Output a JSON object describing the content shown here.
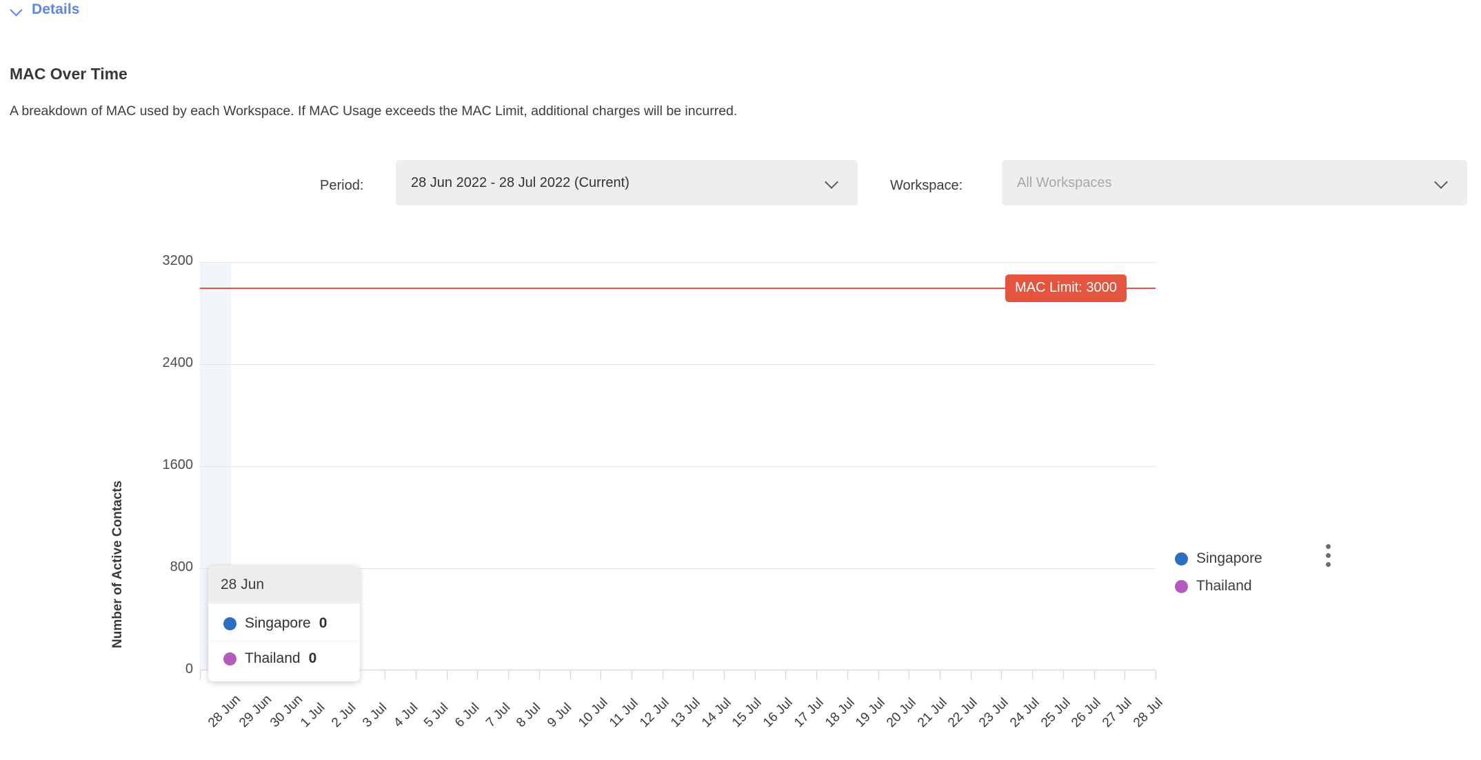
{
  "details": {
    "label": "Details",
    "icon": "chevron-down-icon"
  },
  "section": {
    "title": "MAC Over Time",
    "description": "A breakdown of MAC used by each Workspace. If MAC Usage exceeds the MAC Limit, additional charges will be incurred."
  },
  "filters": {
    "period": {
      "label": "Period:",
      "value": "28 Jun 2022 - 28 Jul 2022 (Current)",
      "caret_icon": "chevron-down-icon"
    },
    "workspace": {
      "label": "Workspace:",
      "value": "All Workspaces",
      "placeholder": "All Workspaces",
      "caret_icon": "chevron-down-icon"
    }
  },
  "legend": {
    "items": [
      {
        "label": "Singapore",
        "color": "#2e6ebf"
      },
      {
        "label": "Thailand",
        "color": "#b45bbf"
      }
    ],
    "menu_icon": "kebab-menu-icon"
  },
  "tooltip": {
    "date": "28 Jun",
    "rows": [
      {
        "label": "Singapore",
        "value": "0",
        "color": "#2e6ebf"
      },
      {
        "label": "Thailand",
        "value": "0",
        "color": "#b45bbf"
      }
    ]
  },
  "limit": {
    "badge": "MAC Limit: 3000",
    "value": 3000,
    "color": "#e4543f"
  },
  "chart_data": {
    "type": "bar",
    "title": "MAC Over Time",
    "xlabel": "",
    "ylabel": "Number of Active Contacts",
    "ylim": [
      0,
      3200
    ],
    "yticks": [
      0,
      800,
      1600,
      2400,
      3200
    ],
    "grid": true,
    "legend_position": "right",
    "categories": [
      "28 Jun",
      "29 Jun",
      "30 Jun",
      "1 Jul",
      "2 Jul",
      "3 Jul",
      "4 Jul",
      "5 Jul",
      "6 Jul",
      "7 Jul",
      "8 Jul",
      "9 Jul",
      "10 Jul",
      "11 Jul",
      "12 Jul",
      "13 Jul",
      "14 Jul",
      "15 Jul",
      "16 Jul",
      "17 Jul",
      "18 Jul",
      "19 Jul",
      "20 Jul",
      "21 Jul",
      "22 Jul",
      "23 Jul",
      "24 Jul",
      "25 Jul",
      "26 Jul",
      "27 Jul",
      "28 Jul"
    ],
    "series": [
      {
        "name": "Singapore",
        "color": "#2e6ebf",
        "values": [
          0,
          0,
          0,
          0,
          0,
          0,
          0,
          0,
          0,
          0,
          0,
          0,
          0,
          0,
          0,
          0,
          0,
          0,
          0,
          0,
          0,
          0,
          0,
          0,
          0,
          0,
          0,
          0,
          0,
          0,
          0
        ]
      },
      {
        "name": "Thailand",
        "color": "#b45bbf",
        "values": [
          0,
          0,
          0,
          0,
          0,
          0,
          0,
          0,
          0,
          0,
          0,
          0,
          0,
          0,
          0,
          0,
          0,
          0,
          0,
          0,
          0,
          0,
          0,
          0,
          0,
          0,
          0,
          0,
          0,
          0,
          0
        ]
      }
    ],
    "reference_lines": [
      {
        "label": "MAC Limit: 3000",
        "value": 3000,
        "color": "#e4543f"
      }
    ],
    "hovered_category": "28 Jun"
  }
}
